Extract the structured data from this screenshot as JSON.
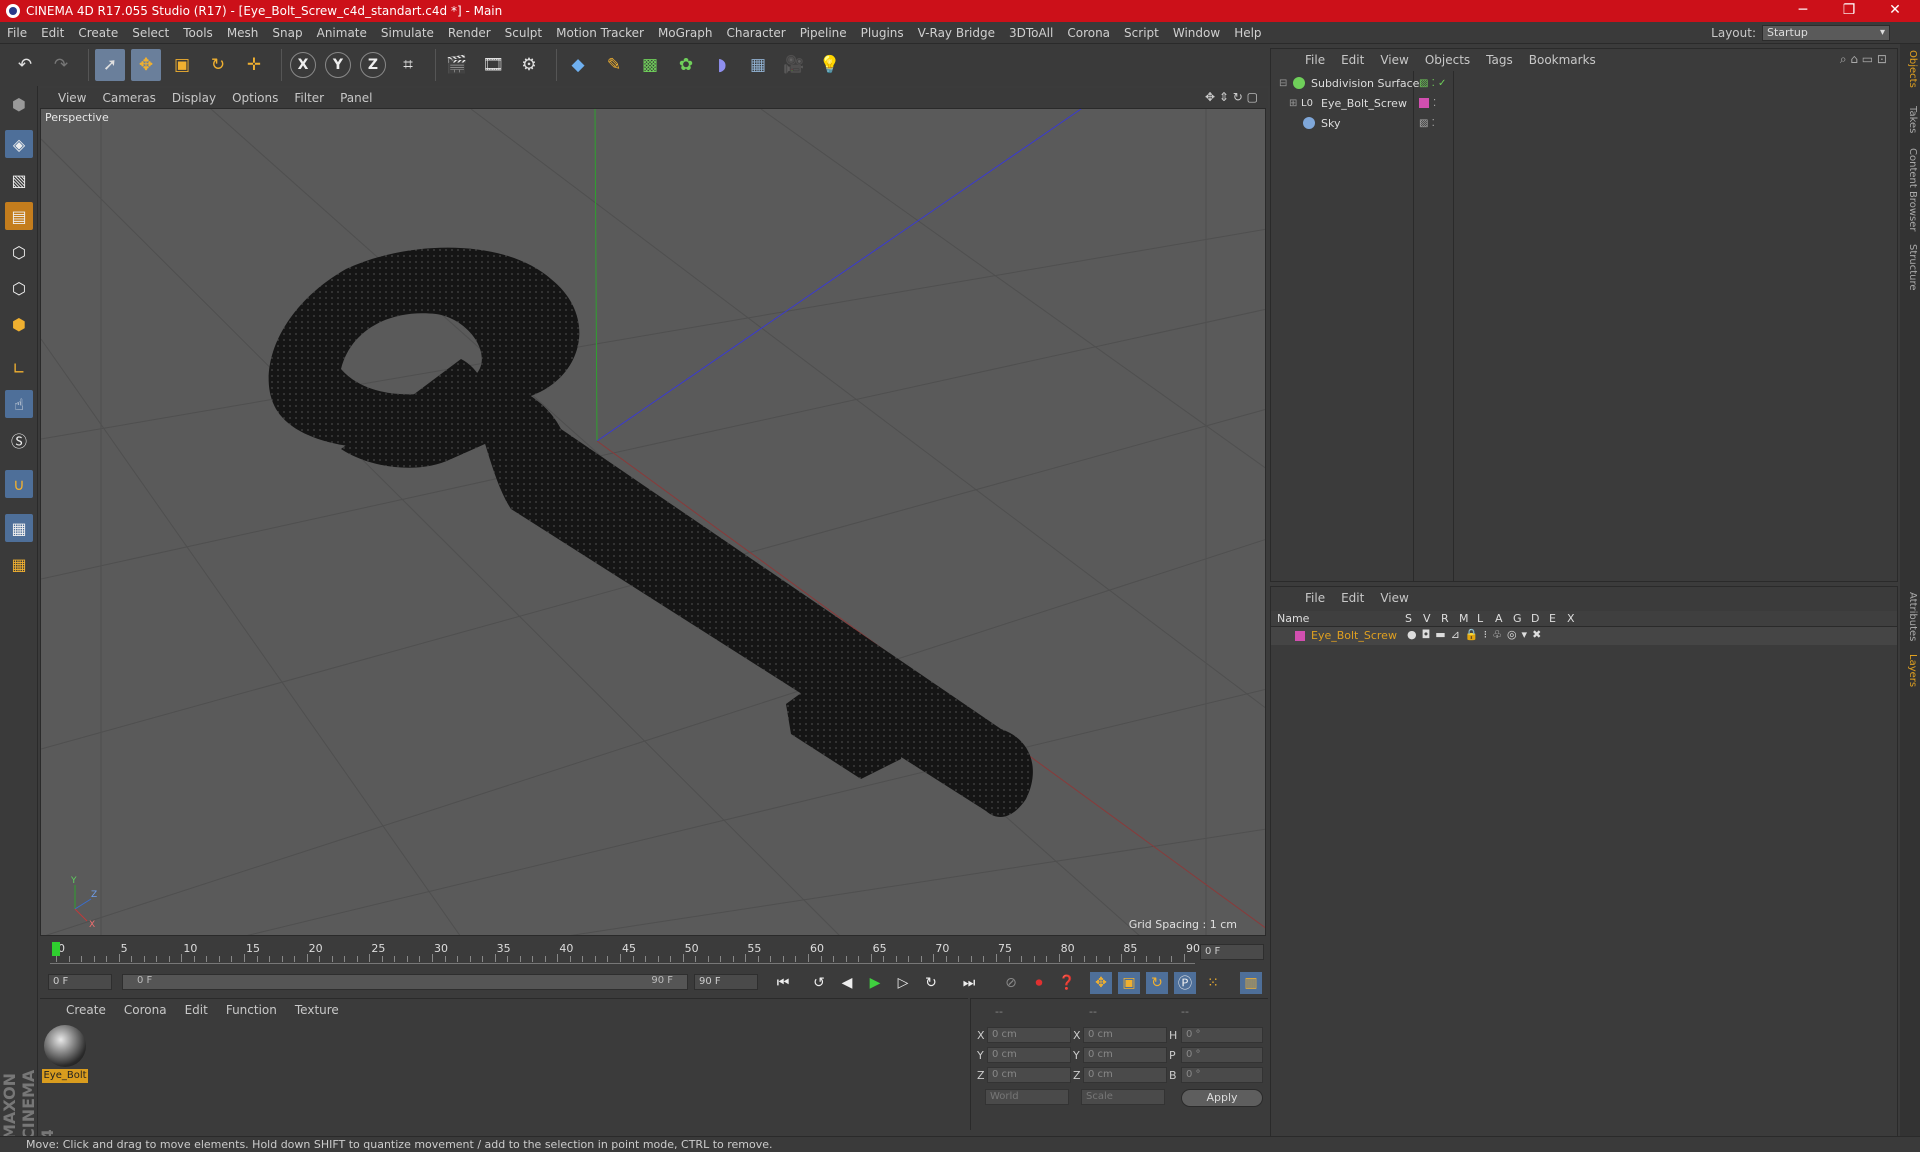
{
  "window": {
    "title": "CINEMA 4D R17.055 Studio (R17) - [Eye_Bolt_Screw_c4d_standart.c4d *] - Main",
    "minimize": "─",
    "maximize": "❐",
    "close": "✕"
  },
  "menu": [
    "File",
    "Edit",
    "Create",
    "Select",
    "Tools",
    "Mesh",
    "Snap",
    "Animate",
    "Simulate",
    "Render",
    "Sculpt",
    "Motion Tracker",
    "MoGraph",
    "Character",
    "Pipeline",
    "Plugins",
    "V-Ray Bridge",
    "3DToAll",
    "Corona",
    "Script",
    "Window",
    "Help"
  ],
  "layout": {
    "label": "Layout:",
    "value": "Startup"
  },
  "toolbar": {
    "axis_x": "X",
    "axis_y": "Y",
    "axis_z": "Z"
  },
  "viewport": {
    "menu": [
      "View",
      "Cameras",
      "Display",
      "Options",
      "Filter",
      "Panel"
    ],
    "label": "Perspective",
    "grid_spacing": "Grid Spacing : 1 cm"
  },
  "timeline": {
    "ticks": [
      "0",
      "5",
      "10",
      "15",
      "20",
      "25",
      "30",
      "35",
      "40",
      "45",
      "50",
      "55",
      "60",
      "65",
      "70",
      "75",
      "80",
      "85",
      "90"
    ],
    "end_field": "0 F"
  },
  "playback": {
    "current": "0 F",
    "range_start": "0 F",
    "range_end": "90 F",
    "max": "90 F"
  },
  "material_manager": {
    "menu": [
      "Create",
      "Corona",
      "Edit",
      "Function",
      "Texture"
    ],
    "material_name": "Eye_Bolt"
  },
  "coordinates": {
    "header": [
      "--",
      "--",
      "--"
    ],
    "rows": [
      {
        "axis": "X",
        "pos": "0 cm",
        "axis2": "X",
        "size": "0 cm",
        "rot_label": "H",
        "rot": "0 °"
      },
      {
        "axis": "Y",
        "pos": "0 cm",
        "axis2": "Y",
        "size": "0 cm",
        "rot_label": "P",
        "rot": "0 °"
      },
      {
        "axis": "Z",
        "pos": "0 cm",
        "axis2": "Z",
        "size": "0 cm",
        "rot_label": "B",
        "rot": "0 °"
      }
    ],
    "world": "World",
    "scale": "Scale",
    "apply": "Apply"
  },
  "object_manager": {
    "menu": [
      "File",
      "Edit",
      "View",
      "Objects",
      "Tags",
      "Bookmarks"
    ],
    "objects": [
      {
        "name": "Subdivision Surface",
        "color": "#6fcf5a"
      },
      {
        "name": "Eye_Bolt_Screw",
        "color": "#d24fb0"
      },
      {
        "name": "Sky",
        "color": "#7fa7d9"
      }
    ]
  },
  "layer_manager": {
    "menu": [
      "File",
      "Edit",
      "View"
    ],
    "columns": [
      "Name",
      "S",
      "V",
      "R",
      "M",
      "L",
      "A",
      "G",
      "D",
      "E",
      "X"
    ],
    "layer": "Eye_Bolt_Screw"
  },
  "right_tabs": [
    "Objects",
    "Takes",
    "Content Browser",
    "Structure",
    "Attributes",
    "Layers"
  ],
  "status": "Move: Click and drag to move elements. Hold down SHIFT to quantize movement / add to the selection in point mode, CTRL to remove.",
  "colors": {
    "accent": "#cc1019",
    "active_tool": "#6a7f9b",
    "material_selected": "#d99c1e",
    "layer_color": "#d24fb0"
  }
}
